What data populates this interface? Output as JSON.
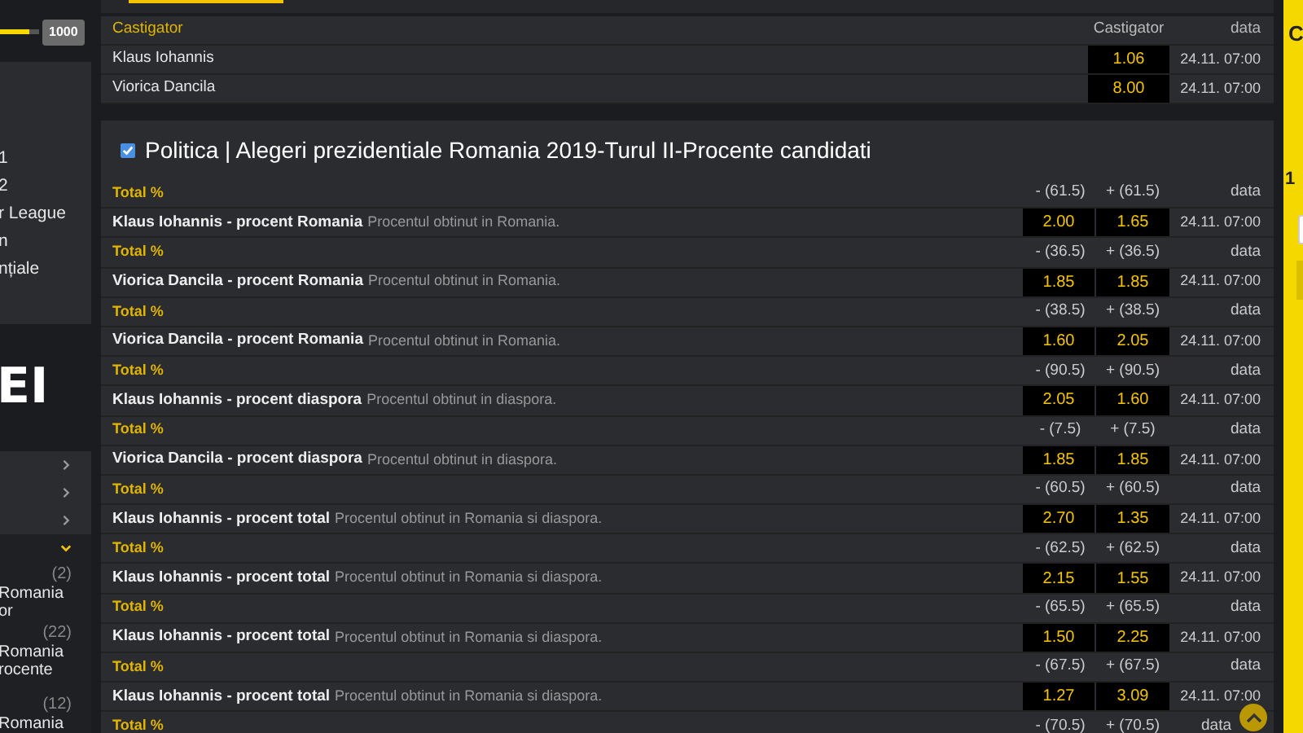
{
  "sidebar": {
    "balance_badge": "1000",
    "slider": {
      "level": 0.75
    },
    "top_items": [
      "1",
      "2",
      "r League",
      "n",
      "nțiale"
    ],
    "banner_text": "EI",
    "groups": [
      {
        "expanded": false
      },
      {
        "expanded": false
      },
      {
        "expanded": false
      },
      {
        "expanded": true,
        "entries": [
          {
            "count": "(2)",
            "lines": [
              "Romania",
              "or"
            ]
          },
          {
            "count": "(22)",
            "lines": [
              "Romania",
              "rocente"
            ]
          },
          {
            "count": "(12)",
            "lines": [
              "Romania"
            ]
          }
        ]
      }
    ]
  },
  "top_tab": {
    "selected": true
  },
  "winner_market": {
    "header": "Castigator",
    "columns": [
      "Castigator",
      "data"
    ],
    "rows": [
      {
        "name": "Klaus Iohannis",
        "odds": "1.06",
        "date": "24.11. 07:00"
      },
      {
        "name": "Viorica Dancila",
        "odds": "8.00",
        "date": "24.11. 07:00"
      }
    ]
  },
  "percent_market": {
    "checked": true,
    "title": "Politica | Alegeri prezidentiale Romania 2019-Turul II-Procente candidati",
    "groups": [
      {
        "label": "Total %",
        "minus": "- (61.5)",
        "plus": "+ (61.5)",
        "date_header": "data",
        "selection": {
          "name": "Klaus Iohannis - procent Romania",
          "note": "Procentul obtinut in Romania.",
          "odds": [
            "2.00",
            "1.65"
          ],
          "date": "24.11. 07:00"
        }
      },
      {
        "label": "Total %",
        "minus": "- (36.5)",
        "plus": "+ (36.5)",
        "date_header": "data",
        "selection": {
          "name": "Viorica Dancila - procent Romania",
          "note": "Procentul obtinut in Romania.",
          "odds": [
            "1.85",
            "1.85"
          ],
          "date": "24.11. 07:00"
        }
      },
      {
        "label": "Total %",
        "minus": "- (38.5)",
        "plus": "+ (38.5)",
        "date_header": "data",
        "selection": {
          "name": "Viorica Dancila - procent Romania",
          "note": "Procentul obtinut in Romania.",
          "odds": [
            "1.60",
            "2.05"
          ],
          "date": "24.11. 07:00"
        }
      },
      {
        "label": "Total %",
        "minus": "- (90.5)",
        "plus": "+ (90.5)",
        "date_header": "data",
        "selection": {
          "name": "Klaus Iohannis - procent diaspora",
          "note": "Procentul obtinut in diaspora.",
          "odds": [
            "2.05",
            "1.60"
          ],
          "date": "24.11. 07:00"
        }
      },
      {
        "label": "Total %",
        "minus": "- (7.5)",
        "plus": "+ (7.5)",
        "date_header": "data",
        "selection": {
          "name": "Viorica Dancila - procent diaspora",
          "note": "Procentul obtinut in diaspora.",
          "odds": [
            "1.85",
            "1.85"
          ],
          "date": "24.11. 07:00"
        }
      },
      {
        "label": "Total %",
        "minus": "- (60.5)",
        "plus": "+ (60.5)",
        "date_header": "data",
        "selection": {
          "name": "Klaus Iohannis - procent total",
          "note": "Procentul obtinut in Romania si diaspora.",
          "odds": [
            "2.70",
            "1.35"
          ],
          "date": "24.11. 07:00"
        }
      },
      {
        "label": "Total %",
        "minus": "- (62.5)",
        "plus": "+ (62.5)",
        "date_header": "data",
        "selection": {
          "name": "Klaus Iohannis - procent total",
          "note": "Procentul obtinut in Romania si diaspora.",
          "odds": [
            "2.15",
            "1.55"
          ],
          "date": "24.11. 07:00"
        }
      },
      {
        "label": "Total %",
        "minus": "- (65.5)",
        "plus": "+ (65.5)",
        "date_header": "data",
        "selection": {
          "name": "Klaus Iohannis - procent total",
          "note": "Procentul obtinut in Romania si diaspora.",
          "odds": [
            "1.50",
            "2.25"
          ],
          "date": "24.11. 07:00"
        }
      },
      {
        "label": "Total %",
        "minus": "- (67.5)",
        "plus": "+ (67.5)",
        "date_header": "data",
        "selection": {
          "name": "Klaus Iohannis - procent total",
          "note": "Procentul obtinut in Romania si diaspora.",
          "odds": [
            "1.27",
            "3.09"
          ],
          "date": "24.11. 07:00"
        }
      },
      {
        "label": "Total %",
        "minus": "- (70.5)",
        "plus": "+ (70.5)",
        "date_header": "data"
      }
    ]
  },
  "bet_slip": {
    "title": "C",
    "line": "1"
  }
}
